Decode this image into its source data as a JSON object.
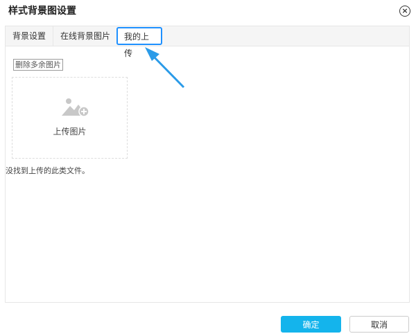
{
  "dialog": {
    "title": "样式背景图设置",
    "close_symbol": "×"
  },
  "tabs": [
    {
      "label": "背景设置"
    },
    {
      "label": "在线背景图片"
    },
    {
      "label": "我的上传"
    }
  ],
  "upload": {
    "delete_label": "删除多余图片",
    "upload_label": "上传图片",
    "empty_message": "没找到上传的此类文件。",
    "icon": "image-add-icon"
  },
  "footer": {
    "ok_label": "确定",
    "cancel_label": "取消"
  },
  "colors": {
    "accent": "#14b4ec",
    "highlight": "#1e90ff"
  }
}
